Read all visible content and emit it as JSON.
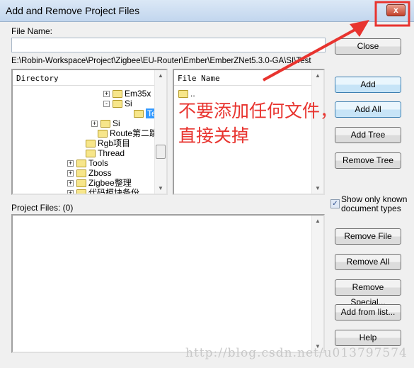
{
  "window": {
    "title": "Add and Remove Project Files",
    "close_glyph": "x"
  },
  "file_name_label": "File Name:",
  "file_name_value": "",
  "path": "E:\\Robin-Workspace\\Project\\Zigbee\\EU-Router\\Ember\\EmberZNet5.3.0-GA\\SI\\Test",
  "directory": {
    "header": "Directory",
    "items": [
      {
        "label": "Em35x",
        "toggle": "+"
      },
      {
        "label": "Si",
        "toggle": "-"
      },
      {
        "label": "Test",
        "selected": true
      },
      {
        "label": "Si",
        "toggle": "+"
      },
      {
        "label": "Route第二跳设计"
      },
      {
        "label": "Rgb项目"
      },
      {
        "label": "Thread"
      },
      {
        "label": "Tools",
        "toggle": "+"
      },
      {
        "label": "Zboss",
        "toggle": "+"
      },
      {
        "label": "Zigbee整理",
        "toggle": "+"
      },
      {
        "label": "代码模块备份",
        "toggle": "+"
      }
    ]
  },
  "file_list": {
    "header": "File Name",
    "items": [
      ".."
    ]
  },
  "project_files_label": "Project Files: (0)",
  "show_known": {
    "label1": "Show only known",
    "label2": "document types",
    "checked": true,
    "check_glyph": "✓"
  },
  "buttons": {
    "close": "Close",
    "add": "Add",
    "add_all": "Add All",
    "add_tree": "Add Tree",
    "remove_tree": "Remove Tree",
    "remove_file": "Remove File",
    "remove_all": "Remove All",
    "remove_special": "Remove Special...",
    "add_from_list": "Add from list...",
    "help": "Help"
  },
  "annotation": {
    "line1": "不要添加任何文件，",
    "line2": "直接关掉",
    "color": "#e8342f"
  },
  "watermark": "http://blog.csdn.net/u013797574"
}
